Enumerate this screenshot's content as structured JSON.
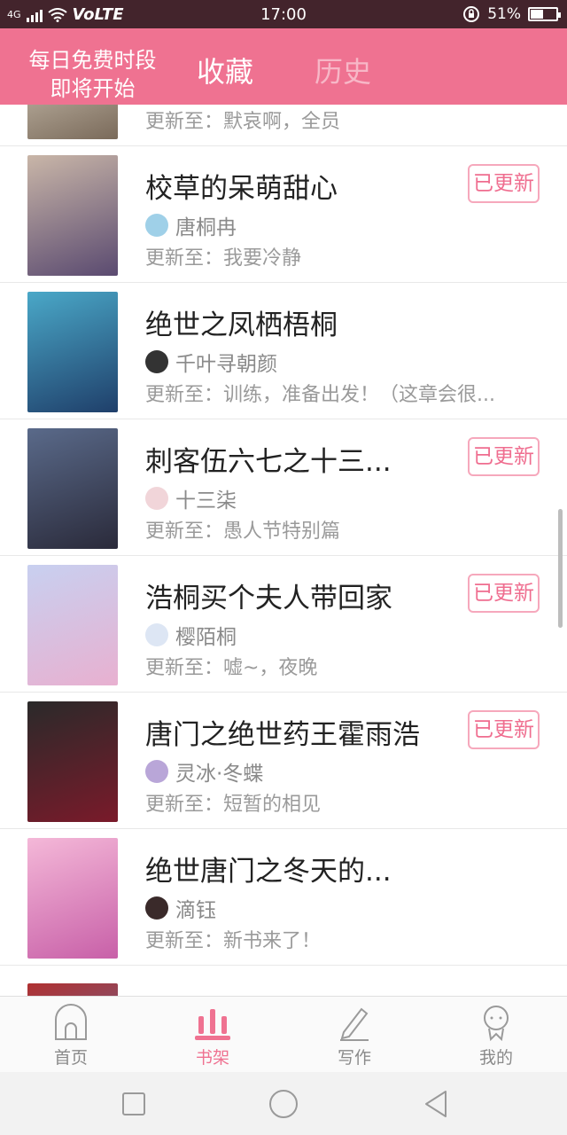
{
  "status_bar": {
    "network": "4G",
    "volte": "VoLTE",
    "time": "17:00",
    "battery": "51%",
    "battery_level": 0.51
  },
  "header": {
    "promo_line1": "每日免费时段",
    "promo_line2": "即将开始",
    "tab_favorites": "收藏",
    "tab_history": "历史"
  },
  "partial_item": {
    "update": "更新至：默哀啊，全员"
  },
  "items": [
    {
      "title": "校草的呆萌甜心",
      "author": "唐桐冉",
      "update": "更新至：我要冷静",
      "badge": "已更新",
      "has_badge": true,
      "cover_colors": [
        "#c9b6a8",
        "#5a4a70"
      ],
      "avatar_color": "#9fd0e8"
    },
    {
      "title": "绝世之凤栖梧桐",
      "author": "千叶寻朝颜",
      "update": "更新至：训练，准备出发！（这章会很...",
      "badge": "",
      "has_badge": false,
      "cover_colors": [
        "#4aa8c8",
        "#1f3f6a"
      ],
      "avatar_color": "#333333"
    },
    {
      "title": "刺客伍六七之十三...",
      "author": "十三柒",
      "update": "更新至：愚人节特别篇",
      "badge": "已更新",
      "has_badge": true,
      "cover_colors": [
        "#5a6a8a",
        "#2a2a3a"
      ],
      "avatar_color": "#f1d5d9"
    },
    {
      "title": "浩桐买个夫人带回家",
      "author": "樱陌桐",
      "update": "更新至：嘘~，夜晚",
      "badge": "已更新",
      "has_badge": true,
      "cover_colors": [
        "#c8d0f0",
        "#e8b0d0"
      ],
      "avatar_color": "#dde6f4"
    },
    {
      "title": "唐门之绝世药王霍雨浩",
      "author": "灵冰·冬蝶",
      "update": "更新至：短暂的相见",
      "badge": "已更新",
      "has_badge": true,
      "cover_colors": [
        "#2a2a2a",
        "#7a1a2a"
      ],
      "avatar_color": "#b9a6d8"
    },
    {
      "title": "绝世唐门之冬天的...",
      "author": "滴钰",
      "update": "更新至：新书来了！",
      "badge": "",
      "has_badge": false,
      "cover_colors": [
        "#f4b8d8",
        "#c860a8"
      ],
      "avatar_color": "#3a2a2a"
    }
  ],
  "bottom_nav": [
    {
      "label": "首页",
      "icon": "home-icon",
      "active": false
    },
    {
      "label": "书架",
      "icon": "bookshelf-icon",
      "active": true
    },
    {
      "label": "写作",
      "icon": "pencil-icon",
      "active": false
    },
    {
      "label": "我的",
      "icon": "profile-icon",
      "active": false
    }
  ],
  "colors": {
    "accent": "#ef7291",
    "status_bar": "#43242c"
  }
}
